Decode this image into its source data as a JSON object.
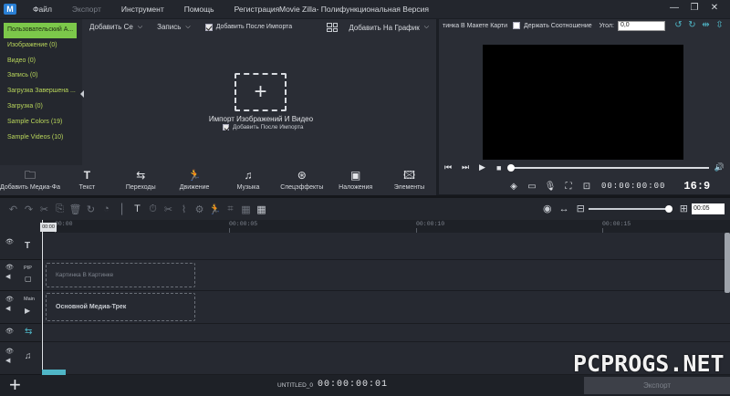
{
  "app": {
    "title": "Movie Zilla- Полифункциональная Версия",
    "logo": "M"
  },
  "menu": [
    {
      "label": "Файл",
      "enabled": true
    },
    {
      "label": "Экспорт",
      "enabled": false
    },
    {
      "label": "Инструмент",
      "enabled": true
    },
    {
      "label": "Помощь",
      "enabled": true
    },
    {
      "label": "Регистрация",
      "enabled": true
    }
  ],
  "window_controls": [
    "minimize-icon",
    "restore-icon",
    "close-icon"
  ],
  "library": {
    "categories": [
      "Пользовательский А...",
      "Изображение (0)",
      "Видео (0)",
      "Запись (0)",
      "Загрузка Завершена ...",
      "Загрузка (0)",
      "Sample Colors (19)",
      "Sample Videos (10)"
    ],
    "add_dropdown": "Добавить Се",
    "record_dropdown": "Запись",
    "add_after_import": "Добавить После Импорта",
    "add_to_graph": "Добавить На График",
    "import_label": "Импорт Изображений И Видео",
    "import_checkbox": "Добавить После Импорта"
  },
  "media_tabs": [
    {
      "label": "Добавить Медиа-Фа",
      "icon": "folder-icon"
    },
    {
      "label": "Текст",
      "icon": "text-icon"
    },
    {
      "label": "Переходы",
      "icon": "transitions-icon"
    },
    {
      "label": "Движение",
      "icon": "motion-icon"
    },
    {
      "label": "Музыка",
      "icon": "music-icon"
    },
    {
      "label": "Спецэффекты",
      "icon": "effects-icon"
    },
    {
      "label": "Наложения",
      "icon": "overlay-icon"
    },
    {
      "label": "Элементы",
      "icon": "elements-icon"
    }
  ],
  "preview": {
    "pip_label": "тинка В Макете Карти",
    "keep_ratio": "Держать Соотношение",
    "angle_label": "Угол:",
    "angle_value": "0,0",
    "timecode": "00:00:00:00",
    "aspect": "16:9",
    "progress": 0
  },
  "timeline": {
    "ruler_labels": [
      "00:00",
      "00:00:05",
      "00:00:10",
      "00:00:15"
    ],
    "playhead_label": "00:00",
    "tracks": [
      {
        "name": "",
        "icon": "text-track-icon"
      },
      {
        "name": "PIP",
        "icon": "pip-track-icon",
        "clip": "Картинка В Картинке"
      },
      {
        "name": "Main",
        "icon": "main-track-icon",
        "clip": "Основной Медиа-Трек"
      },
      {
        "name": "",
        "icon": "transition-track-icon"
      },
      {
        "name": "",
        "icon": "music-track-icon"
      }
    ],
    "zoom_value": "00:05"
  },
  "bottom": {
    "project_name": "UNTITLED_0",
    "timecode": "00:00:00:01",
    "export_label": "Экспорт"
  },
  "watermark": "PCPROGS.NET",
  "colors": {
    "accent_green": "#7cc84a",
    "accent_teal": "#4fb6c7",
    "background": "#1b1e24",
    "panel": "#2a2d35"
  }
}
